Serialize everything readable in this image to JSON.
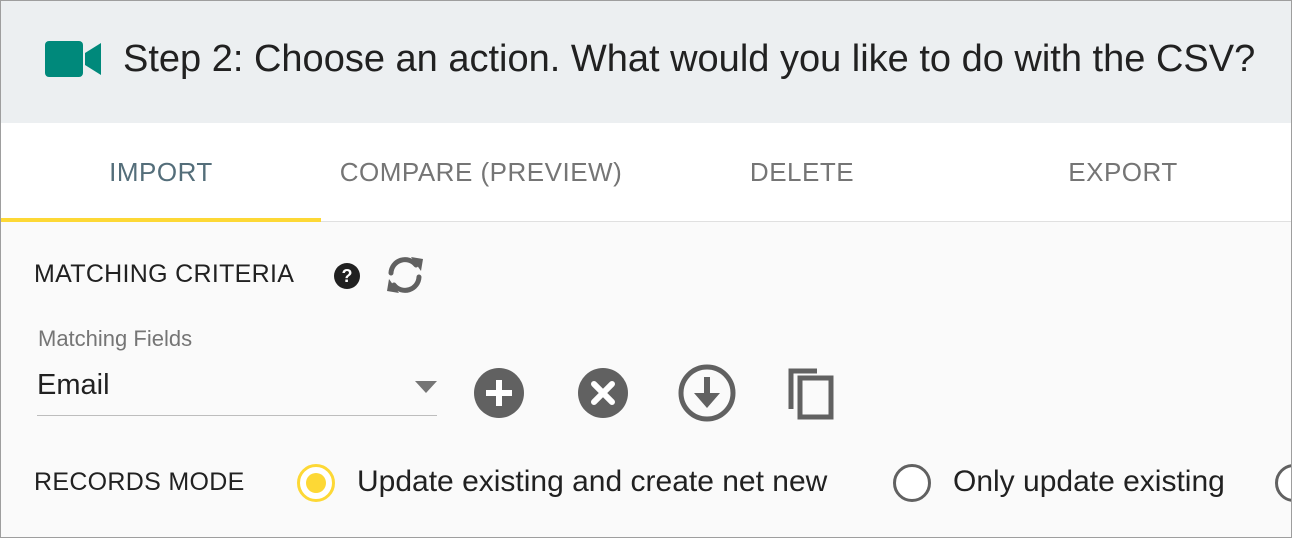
{
  "header": {
    "title": "Step 2: Choose an action. What would you like to do with the CSV?",
    "icon": "video-camera-icon",
    "icon_color": "#00897b"
  },
  "tabs": [
    {
      "label": "IMPORT",
      "active": true
    },
    {
      "label": "COMPARE (PREVIEW)",
      "active": false
    },
    {
      "label": "DELETE",
      "active": false
    },
    {
      "label": "EXPORT",
      "active": false
    }
  ],
  "accent_color": "#fdd835",
  "matching": {
    "section_title": "MATCHING CRITERIA",
    "help_icon": "help-icon",
    "refresh_icon": "refresh-icon",
    "field_label": "Matching Fields",
    "field_value": "Email",
    "actions": [
      {
        "name": "add-circle-icon"
      },
      {
        "name": "remove-circle-icon"
      },
      {
        "name": "download-circle-icon"
      },
      {
        "name": "copy-icon"
      }
    ]
  },
  "records_mode": {
    "section_title": "RECORDS MODE",
    "options": [
      {
        "label": "Update existing and create net new",
        "checked": true
      },
      {
        "label": "Only update existing",
        "checked": false
      }
    ]
  }
}
